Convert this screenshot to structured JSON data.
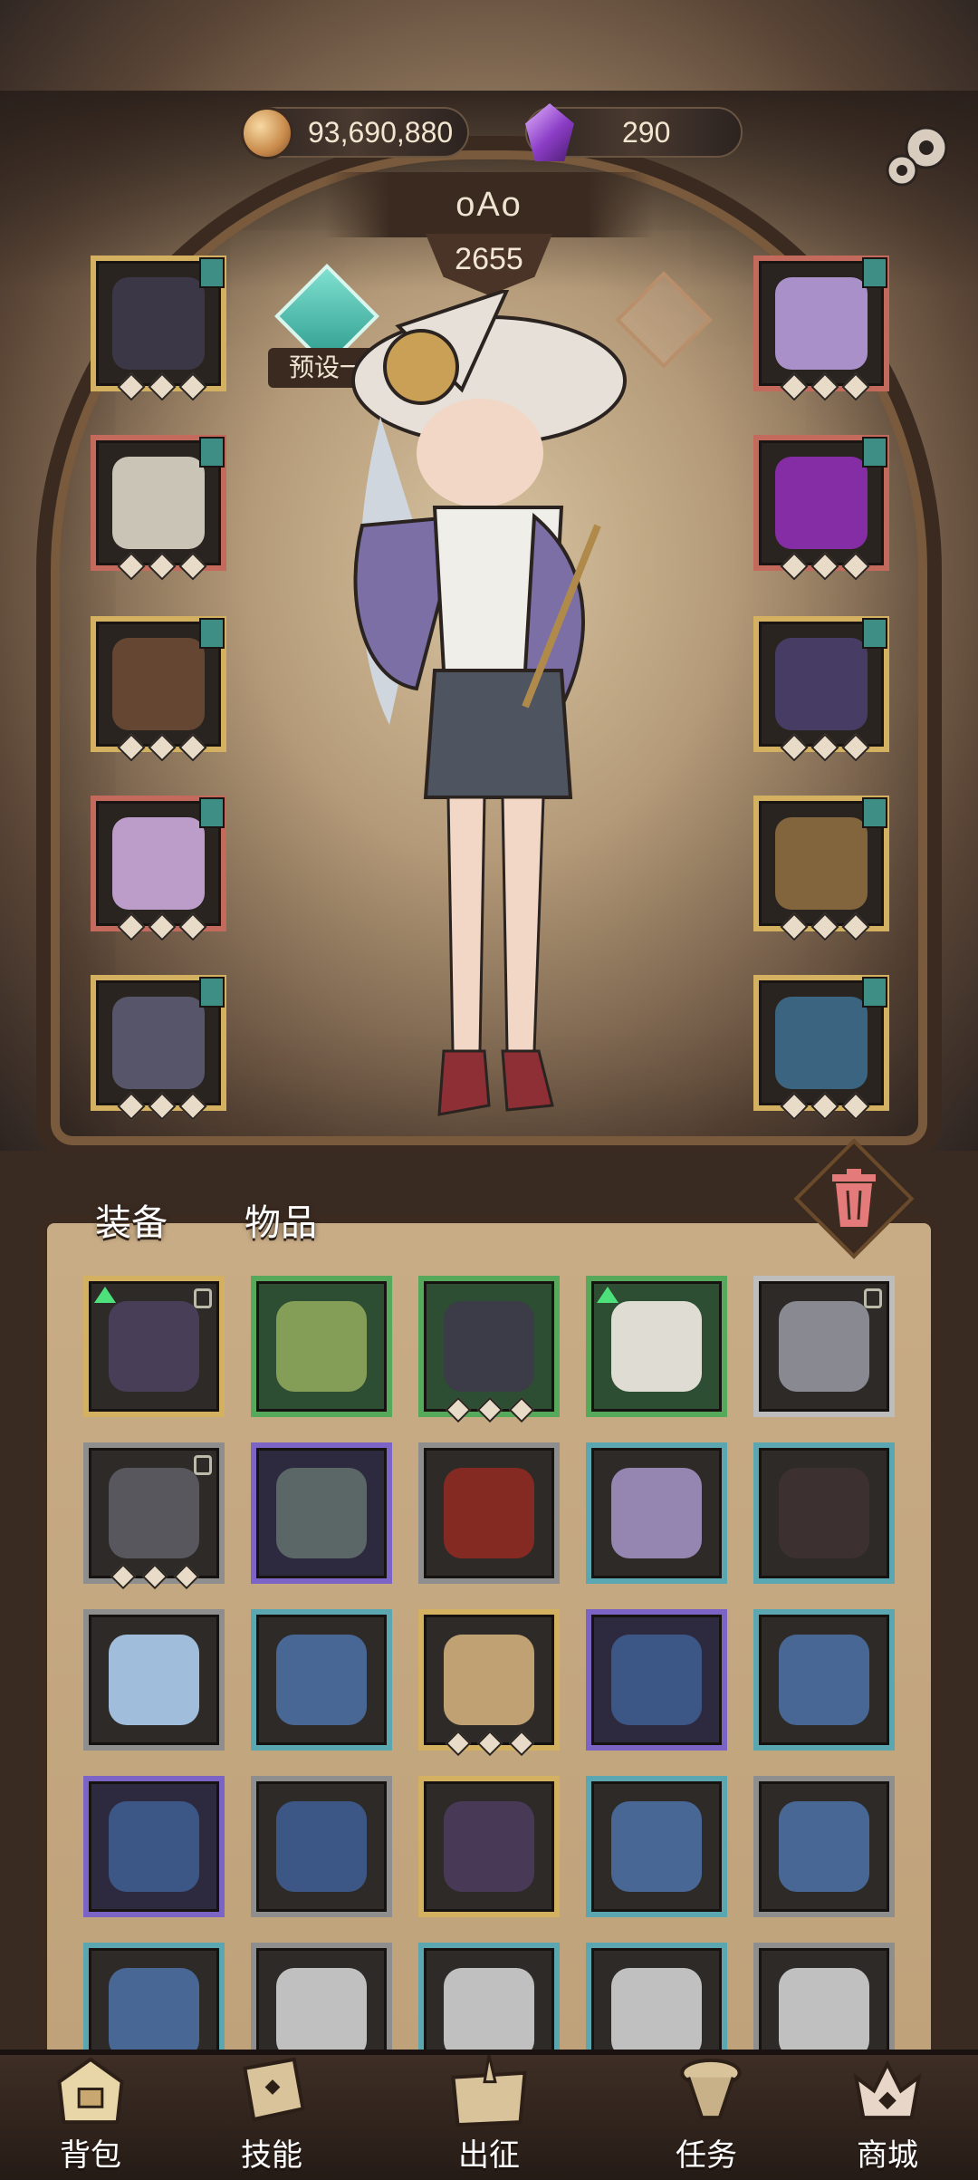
{
  "header": {
    "gold": "93,690,880",
    "gems": "290",
    "player_name": "oAo",
    "power": "2655",
    "preset_label": "预设一"
  },
  "colors": {
    "accent_teal": "#3f8e86",
    "frame_gold": "#d4b160",
    "upgrade_green": "#4ee07a"
  },
  "equipment_left": [
    {
      "name": "helmet",
      "frame": "gold",
      "color": "#3d3a4a"
    },
    {
      "name": "chest",
      "frame": "red",
      "color": "#d8d2c4"
    },
    {
      "name": "gloves",
      "frame": "gold",
      "color": "#6a4a35"
    },
    {
      "name": "pants",
      "frame": "red",
      "color": "#c9a8d8"
    },
    {
      "name": "boots",
      "frame": "gold",
      "color": "#5b5a70"
    }
  ],
  "equipment_right": [
    {
      "name": "amulet",
      "frame": "red",
      "color": "#b49ad8"
    },
    {
      "name": "ring",
      "frame": "red",
      "color": "#8c2fb0"
    },
    {
      "name": "bracelet",
      "frame": "gold",
      "color": "#4a3f6a"
    },
    {
      "name": "staff",
      "frame": "gold",
      "color": "#8a6a40"
    },
    {
      "name": "tome",
      "frame": "gold",
      "color": "#3d6a8a"
    }
  ],
  "tabs": {
    "equipment": "装备",
    "items": "物品"
  },
  "inventory": [
    {
      "icon": "skull-gauntlet",
      "frame": "gold",
      "color": "#4a3f5a",
      "up": true,
      "lock": true
    },
    {
      "icon": "green-armor",
      "frame": "green",
      "color": "#8aa25a",
      "up": false,
      "lock": false
    },
    {
      "icon": "gem-necklace",
      "frame": "green",
      "color": "#3d3a4a",
      "up": false,
      "lock": false
    },
    {
      "icon": "white-pants",
      "frame": "green",
      "color": "#e8e4dc",
      "up": true,
      "lock": false
    },
    {
      "icon": "pink-ring",
      "frame": "silver",
      "color": "#8e8e98",
      "up": false,
      "lock": true
    },
    {
      "icon": "chain-ring",
      "frame": "dark",
      "color": "#5b5a60",
      "up": false,
      "lock": true
    },
    {
      "icon": "gray-boots",
      "frame": "purple",
      "color": "#5e6a68",
      "up": false,
      "lock": false
    },
    {
      "icon": "red-gauntlet",
      "frame": "dark",
      "color": "#8a2a22",
      "up": false,
      "lock": false
    },
    {
      "icon": "orb-wand",
      "frame": "teal",
      "color": "#9a8ab8",
      "up": false,
      "lock": false
    },
    {
      "icon": "dark-boots",
      "frame": "teal",
      "color": "#3d3030",
      "up": false,
      "lock": false
    },
    {
      "icon": "crystal-spear",
      "frame": "dark",
      "color": "#a6c6e6",
      "up": false,
      "lock": false
    },
    {
      "icon": "crystal-pendant",
      "frame": "teal",
      "color": "#4a6a9a",
      "up": false,
      "lock": false
    },
    {
      "icon": "fist-ring",
      "frame": "gold",
      "color": "#c8a878",
      "up": false,
      "lock": false
    },
    {
      "icon": "gem-ring",
      "frame": "purple",
      "color": "#3d5a8a",
      "up": false,
      "lock": false
    },
    {
      "icon": "crystal-pendant",
      "frame": "teal",
      "color": "#4a6a9a",
      "up": false,
      "lock": false
    },
    {
      "icon": "gem-ring",
      "frame": "purple",
      "color": "#3d5a8a",
      "up": false,
      "lock": false
    },
    {
      "icon": "gem-ring",
      "frame": "dark",
      "color": "#3d5a8a",
      "up": false,
      "lock": false
    },
    {
      "icon": "dark-bracelet",
      "frame": "gold",
      "color": "#4a3a5a",
      "up": false,
      "lock": false
    },
    {
      "icon": "crystal-pendant",
      "frame": "teal",
      "color": "#4a6a9a",
      "up": false,
      "lock": false
    },
    {
      "icon": "crystal-pendant",
      "frame": "dark",
      "color": "#4a6a9a",
      "up": false,
      "lock": false
    },
    {
      "icon": "crystal-pendant",
      "frame": "teal",
      "color": "#4a6a9a",
      "up": false,
      "lock": false
    },
    {
      "icon": "silver-wand",
      "frame": "dark",
      "color": "#c8c8c8",
      "up": false,
      "lock": false
    },
    {
      "icon": "silver-wand",
      "frame": "teal",
      "color": "#c8c8c8",
      "up": false,
      "lock": false
    },
    {
      "icon": "silver-wand",
      "frame": "teal",
      "color": "#c8c8c8",
      "up": false,
      "lock": false
    },
    {
      "icon": "silver-wand",
      "frame": "dark",
      "color": "#c8c8c8",
      "up": false,
      "lock": false
    }
  ],
  "nav": {
    "bag": "背包",
    "skills": "技能",
    "battle": "出征",
    "tasks": "任务",
    "shop": "商城"
  }
}
